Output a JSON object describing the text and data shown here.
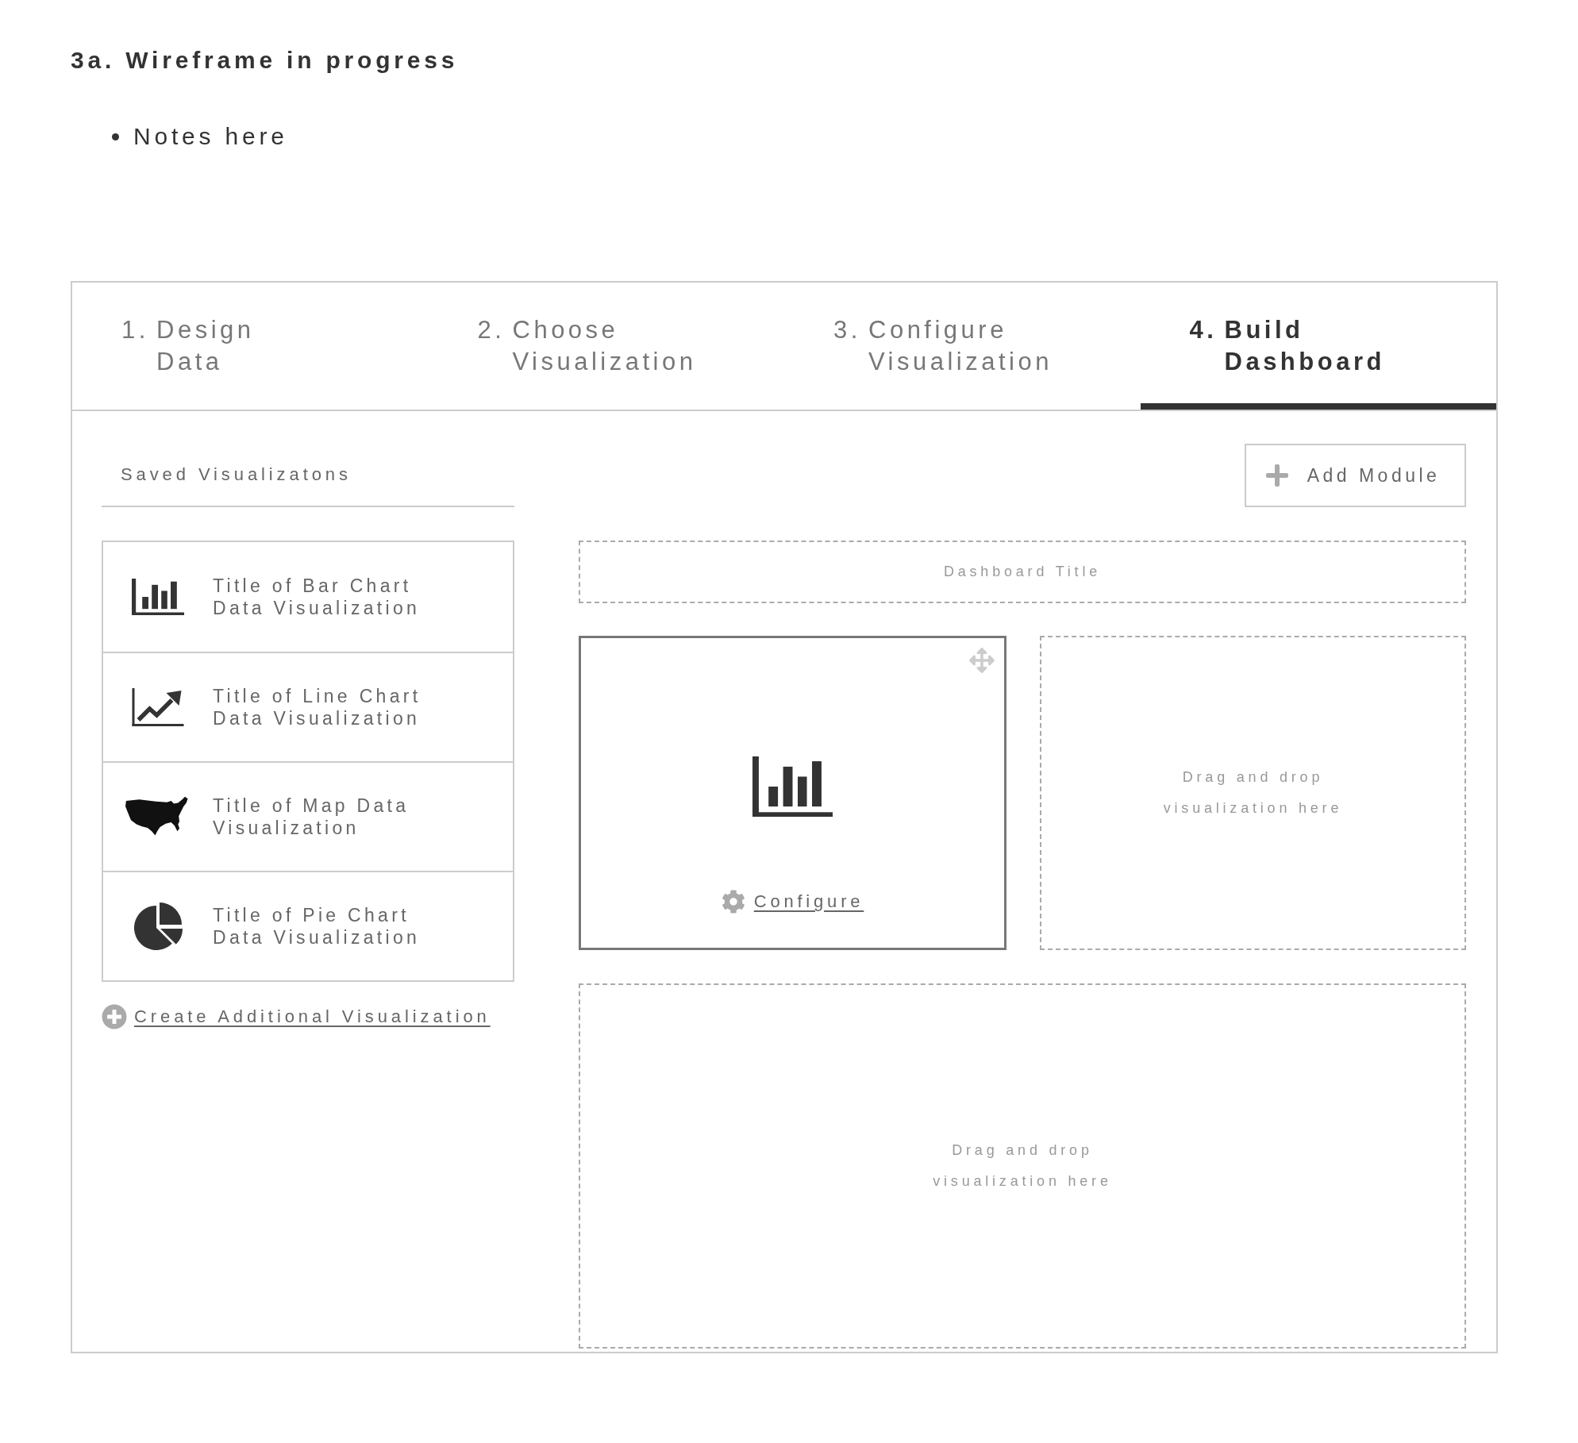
{
  "heading": "3a. Wireframe in progress",
  "notes": [
    "Notes here"
  ],
  "tabs": [
    {
      "number": "1.",
      "label": "Design Data",
      "selected": false
    },
    {
      "number": "2.",
      "label": "Choose Visualization",
      "selected": false
    },
    {
      "number": "3.",
      "label": "Configure Visualization",
      "selected": false
    },
    {
      "number": "4.",
      "label": "Build Dashboard",
      "selected": true
    }
  ],
  "sidebar": {
    "title": "Saved Visualizatons",
    "items": [
      {
        "kind": "bar",
        "title": "Title of Bar Chart Data Visualization"
      },
      {
        "kind": "line",
        "title": "Title of Line Chart Data Visualization"
      },
      {
        "kind": "map",
        "title": "Title of Map Data Visualization"
      },
      {
        "kind": "pie",
        "title": "Title of Pie Chart Data Visualization"
      }
    ],
    "create_link": "Create Additional Visualization"
  },
  "dashboard": {
    "add_button": "Add Module",
    "title_field": {
      "placeholder": "Dashboard Title"
    },
    "rows": [
      {
        "modules": [
          {
            "kind": "bar",
            "link": "Configure"
          },
          {
            "kind": "dropzone",
            "text": "Drag and drop visualization here"
          }
        ]
      },
      {
        "modules": [
          {
            "kind": "dropzone",
            "text": "Drag and drop visualization here"
          }
        ]
      }
    ]
  }
}
